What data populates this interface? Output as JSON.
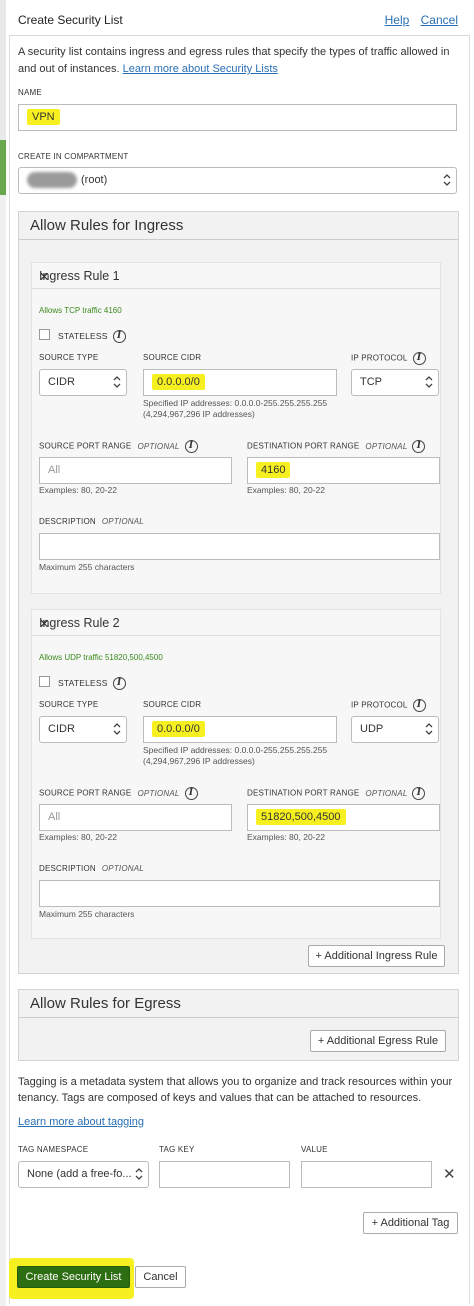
{
  "header": {
    "title": "Create Security List",
    "help": "Help",
    "cancel": "Cancel"
  },
  "intro": {
    "line1": "A security list contains ingress and egress rules that specify the types of traffic allowed in",
    "line2": "and out of instances.",
    "link": "Learn more about Security Lists"
  },
  "name": {
    "label": "NAME",
    "value": "VPN"
  },
  "compartment": {
    "label": "CREATE IN COMPARTMENT",
    "value": "(root)"
  },
  "ingress": {
    "title": "Allow Rules for Ingress",
    "add_button": "+ Additional Ingress Rule",
    "rules": [
      {
        "title": "Ingress Rule 1",
        "summary": "Allows TCP traffic 4160",
        "stateless": "STATELESS",
        "source_type_label": "SOURCE TYPE",
        "source_type": "CIDR",
        "source_cidr_label": "SOURCE CIDR",
        "source_cidr": "0.0.0.0/0",
        "cidr_help1": "Specified IP addresses: 0.0.0.0-255.255.255.255",
        "cidr_help2": "(4,294,967,296 IP addresses)",
        "protocol_label": "IP PROTOCOL",
        "protocol": "TCP",
        "src_port_label": "SOURCE PORT RANGE",
        "optional": "OPTIONAL",
        "src_port_placeholder": "All",
        "dst_port_label": "DESTINATION PORT RANGE",
        "dst_port": "4160",
        "examples": "Examples: 80, 20-22",
        "desc_label": "DESCRIPTION",
        "desc_help": "Maximum 255 characters"
      },
      {
        "title": "Ingress Rule 2",
        "summary": "Allows UDP traffic 51820,500,4500",
        "stateless": "STATELESS",
        "source_type_label": "SOURCE TYPE",
        "source_type": "CIDR",
        "source_cidr_label": "SOURCE CIDR",
        "source_cidr": "0.0.0.0/0",
        "cidr_help1": "Specified IP addresses: 0.0.0.0-255.255.255.255",
        "cidr_help2": "(4,294,967,296 IP addresses)",
        "protocol_label": "IP PROTOCOL",
        "protocol": "UDP",
        "src_port_label": "SOURCE PORT RANGE",
        "optional": "OPTIONAL",
        "src_port_placeholder": "All",
        "dst_port_label": "DESTINATION PORT RANGE",
        "dst_port": "51820,500,4500",
        "examples": "Examples: 80, 20-22",
        "desc_label": "DESCRIPTION",
        "desc_help": "Maximum 255 characters"
      }
    ]
  },
  "egress": {
    "title": "Allow Rules for Egress",
    "add_button": "+ Additional Egress Rule"
  },
  "tagging": {
    "line1": "Tagging is a metadata system that allows you to organize and track resources within your",
    "line2": "tenancy. Tags are composed of keys and values that can be attached to resources.",
    "link": "Learn more about tagging",
    "ns_label": "TAG NAMESPACE",
    "key_label": "TAG KEY",
    "value_label": "VALUE",
    "ns_value": "None (add a free-fo...",
    "add_button": "+ Additional Tag"
  },
  "footer": {
    "create": "Create Security List",
    "cancel": "Cancel"
  },
  "colors": {
    "highlight": "#f7f021",
    "primary": "#2e6e12",
    "link": "#2a6fb3",
    "summary_green": "#3a8a1c"
  }
}
